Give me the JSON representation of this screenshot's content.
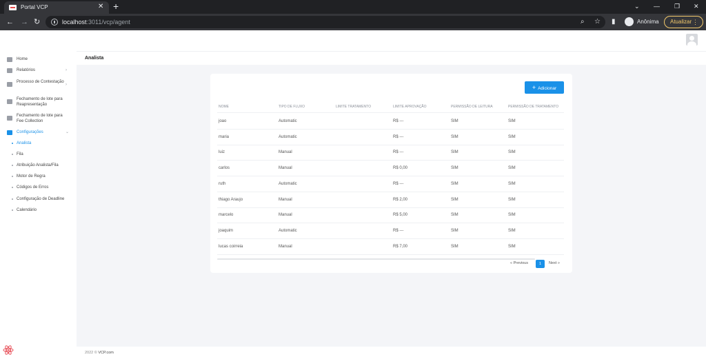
{
  "browser": {
    "tab_title": "Portal VCP",
    "tab_close": "✕",
    "new_tab": "+",
    "url_host": "localhost",
    "url_path": ":3011/vcp/agent",
    "profile_name": "Anônima",
    "update_label": "Atualizar",
    "update_menu": "⋮",
    "win_minimize": "⌄",
    "win_min": "—",
    "win_restore": "❐",
    "win_close": "✕",
    "back": "←",
    "forward": "→",
    "reload": "↻",
    "zoom_icon": "⌕",
    "star_icon": "☆",
    "sidepanel_icon": "▮"
  },
  "sidebar": {
    "items": [
      {
        "label": "Home",
        "chevron": ""
      },
      {
        "label": "Relatórios",
        "chevron": "›"
      },
      {
        "label": "Processo de Contestação",
        "chevron": "›"
      },
      {
        "label": "Fechamento de lote para Reapresentação",
        "chevron": ""
      },
      {
        "label": "Fechamento de lote para Fee Collection",
        "chevron": ""
      },
      {
        "label": "Configurações",
        "chevron": "⌄"
      }
    ],
    "sub_items": [
      "Analista",
      "Fila",
      "Atribuição Analista/Fila",
      "Motor de Regra",
      "Códigos de Erros",
      "Configuração de Deadline",
      "Calendário"
    ]
  },
  "header": {
    "page_title": "Analista"
  },
  "main": {
    "add_plus": "+",
    "add_button": "Adicionar",
    "columns": [
      "Nome",
      "Tipo de fluxo",
      "Limite tratamento",
      "Limite aprovação",
      "Permissão de leitura",
      "Permissão de tratamento"
    ],
    "rows": [
      [
        "joao",
        "Automatic",
        "",
        "R$ ---",
        "SIM",
        "SIM"
      ],
      [
        "maria",
        "Automatic",
        "",
        "R$ ---",
        "SIM",
        "SIM"
      ],
      [
        "luiz",
        "Manual",
        "",
        "R$ ---",
        "SIM",
        "SIM"
      ],
      [
        "carlos",
        "Manual",
        "",
        "R$ 0,00",
        "SIM",
        "SIM"
      ],
      [
        "ruth",
        "Automatic",
        "",
        "R$ ---",
        "SIM",
        "SIM"
      ],
      [
        "thiago Araujo",
        "Manual",
        "",
        "R$ 2,00",
        "SIM",
        "SIM"
      ],
      [
        "marcelo",
        "Manual",
        "",
        "R$ 5,00",
        "SIM",
        "SIM"
      ],
      [
        "joaquim",
        "Automatic",
        "",
        "R$ ---",
        "SIM",
        "SIM"
      ],
      [
        "lucas coirreia",
        "Manual",
        "",
        "R$ 7,00",
        "SIM",
        "SIM"
      ]
    ],
    "pagination": {
      "prev": "« Previous",
      "current": "1",
      "next": "Next »"
    }
  },
  "footer": {
    "text": "2022 © ",
    "brand": "VCP.com"
  },
  "colors": {
    "accent": "#1a91e8",
    "chrome_dark": "#202124",
    "update_gold": "#f3c96a"
  }
}
